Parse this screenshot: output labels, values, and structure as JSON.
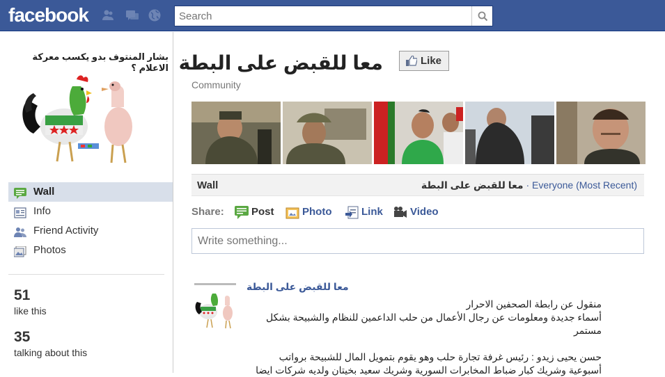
{
  "header": {
    "logo": "facebook",
    "search_placeholder": "Search"
  },
  "sidebar": {
    "caption": "بشار المنتوف بدو يكسب معركة الاعلام ؟",
    "nav": [
      {
        "label": "Wall",
        "icon": "wall-icon",
        "active": true
      },
      {
        "label": "Info",
        "icon": "info-icon",
        "active": false
      },
      {
        "label": "Friend Activity",
        "icon": "friends-icon",
        "active": false
      },
      {
        "label": "Photos",
        "icon": "photos-icon",
        "active": false
      }
    ],
    "stats": [
      {
        "num": "51",
        "label": "like this"
      },
      {
        "num": "35",
        "label": "talking about this"
      }
    ]
  },
  "main": {
    "title": "معا للقبض على البطة",
    "like_label": "Like",
    "category": "Community",
    "wall": {
      "label": "Wall",
      "page_name": "معا للقبض على البطة",
      "separator": "·",
      "filter": "Everyone (Most Recent)"
    },
    "share": {
      "label": "Share:",
      "items": [
        {
          "label": "Post",
          "icon": "post-icon"
        },
        {
          "label": "Photo",
          "icon": "photo-icon"
        },
        {
          "label": "Link",
          "icon": "link-icon"
        },
        {
          "label": "Video",
          "icon": "video-icon"
        }
      ]
    },
    "composer_placeholder": "Write something...",
    "post": {
      "author": "معا للقبض على البطة",
      "lines": [
        "منقول عن رابطة الصحفين الاحرار",
        "أسماء جديدة ومعلومات عن رجال الأعمال من حلب الداعمين للنظام والشبيحة بشكل",
        "مستمر",
        "",
        "حسن يحيى زيدو : رئيس غرفة تجارة حلب وهو يقوم بتمويل المال للشبيحة برواتب",
        "أسبوعية وشريك كبار ضباط المخابرات السورية وشريك سعيد بخيتان ولديه شركات ايضا"
      ]
    }
  },
  "colors": {
    "brand": "#3b5998",
    "nav_active": "#d8dfea"
  }
}
